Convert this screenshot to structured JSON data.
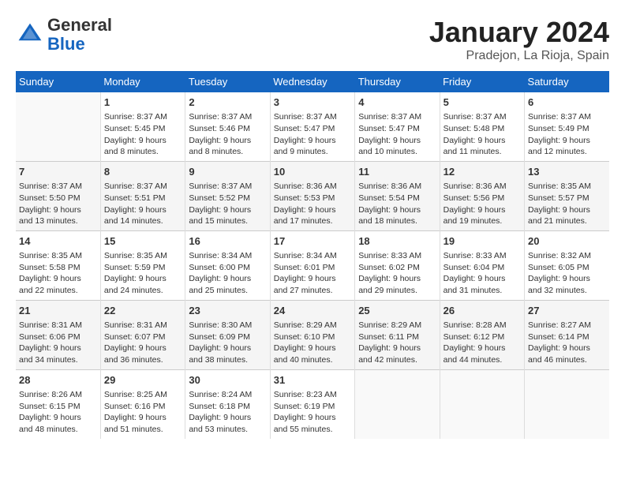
{
  "header": {
    "logo_general": "General",
    "logo_blue": "Blue",
    "month_title": "January 2024",
    "location": "Pradejon, La Rioja, Spain"
  },
  "days_of_week": [
    "Sunday",
    "Monday",
    "Tuesday",
    "Wednesday",
    "Thursday",
    "Friday",
    "Saturday"
  ],
  "weeks": [
    [
      {
        "day": "",
        "info": ""
      },
      {
        "day": "1",
        "info": "Sunrise: 8:37 AM\nSunset: 5:45 PM\nDaylight: 9 hours\nand 8 minutes."
      },
      {
        "day": "2",
        "info": "Sunrise: 8:37 AM\nSunset: 5:46 PM\nDaylight: 9 hours\nand 8 minutes."
      },
      {
        "day": "3",
        "info": "Sunrise: 8:37 AM\nSunset: 5:47 PM\nDaylight: 9 hours\nand 9 minutes."
      },
      {
        "day": "4",
        "info": "Sunrise: 8:37 AM\nSunset: 5:47 PM\nDaylight: 9 hours\nand 10 minutes."
      },
      {
        "day": "5",
        "info": "Sunrise: 8:37 AM\nSunset: 5:48 PM\nDaylight: 9 hours\nand 11 minutes."
      },
      {
        "day": "6",
        "info": "Sunrise: 8:37 AM\nSunset: 5:49 PM\nDaylight: 9 hours\nand 12 minutes."
      }
    ],
    [
      {
        "day": "7",
        "info": "Sunrise: 8:37 AM\nSunset: 5:50 PM\nDaylight: 9 hours\nand 13 minutes."
      },
      {
        "day": "8",
        "info": "Sunrise: 8:37 AM\nSunset: 5:51 PM\nDaylight: 9 hours\nand 14 minutes."
      },
      {
        "day": "9",
        "info": "Sunrise: 8:37 AM\nSunset: 5:52 PM\nDaylight: 9 hours\nand 15 minutes."
      },
      {
        "day": "10",
        "info": "Sunrise: 8:36 AM\nSunset: 5:53 PM\nDaylight: 9 hours\nand 17 minutes."
      },
      {
        "day": "11",
        "info": "Sunrise: 8:36 AM\nSunset: 5:54 PM\nDaylight: 9 hours\nand 18 minutes."
      },
      {
        "day": "12",
        "info": "Sunrise: 8:36 AM\nSunset: 5:56 PM\nDaylight: 9 hours\nand 19 minutes."
      },
      {
        "day": "13",
        "info": "Sunrise: 8:35 AM\nSunset: 5:57 PM\nDaylight: 9 hours\nand 21 minutes."
      }
    ],
    [
      {
        "day": "14",
        "info": "Sunrise: 8:35 AM\nSunset: 5:58 PM\nDaylight: 9 hours\nand 22 minutes."
      },
      {
        "day": "15",
        "info": "Sunrise: 8:35 AM\nSunset: 5:59 PM\nDaylight: 9 hours\nand 24 minutes."
      },
      {
        "day": "16",
        "info": "Sunrise: 8:34 AM\nSunset: 6:00 PM\nDaylight: 9 hours\nand 25 minutes."
      },
      {
        "day": "17",
        "info": "Sunrise: 8:34 AM\nSunset: 6:01 PM\nDaylight: 9 hours\nand 27 minutes."
      },
      {
        "day": "18",
        "info": "Sunrise: 8:33 AM\nSunset: 6:02 PM\nDaylight: 9 hours\nand 29 minutes."
      },
      {
        "day": "19",
        "info": "Sunrise: 8:33 AM\nSunset: 6:04 PM\nDaylight: 9 hours\nand 31 minutes."
      },
      {
        "day": "20",
        "info": "Sunrise: 8:32 AM\nSunset: 6:05 PM\nDaylight: 9 hours\nand 32 minutes."
      }
    ],
    [
      {
        "day": "21",
        "info": "Sunrise: 8:31 AM\nSunset: 6:06 PM\nDaylight: 9 hours\nand 34 minutes."
      },
      {
        "day": "22",
        "info": "Sunrise: 8:31 AM\nSunset: 6:07 PM\nDaylight: 9 hours\nand 36 minutes."
      },
      {
        "day": "23",
        "info": "Sunrise: 8:30 AM\nSunset: 6:09 PM\nDaylight: 9 hours\nand 38 minutes."
      },
      {
        "day": "24",
        "info": "Sunrise: 8:29 AM\nSunset: 6:10 PM\nDaylight: 9 hours\nand 40 minutes."
      },
      {
        "day": "25",
        "info": "Sunrise: 8:29 AM\nSunset: 6:11 PM\nDaylight: 9 hours\nand 42 minutes."
      },
      {
        "day": "26",
        "info": "Sunrise: 8:28 AM\nSunset: 6:12 PM\nDaylight: 9 hours\nand 44 minutes."
      },
      {
        "day": "27",
        "info": "Sunrise: 8:27 AM\nSunset: 6:14 PM\nDaylight: 9 hours\nand 46 minutes."
      }
    ],
    [
      {
        "day": "28",
        "info": "Sunrise: 8:26 AM\nSunset: 6:15 PM\nDaylight: 9 hours\nand 48 minutes."
      },
      {
        "day": "29",
        "info": "Sunrise: 8:25 AM\nSunset: 6:16 PM\nDaylight: 9 hours\nand 51 minutes."
      },
      {
        "day": "30",
        "info": "Sunrise: 8:24 AM\nSunset: 6:18 PM\nDaylight: 9 hours\nand 53 minutes."
      },
      {
        "day": "31",
        "info": "Sunrise: 8:23 AM\nSunset: 6:19 PM\nDaylight: 9 hours\nand 55 minutes."
      },
      {
        "day": "",
        "info": ""
      },
      {
        "day": "",
        "info": ""
      },
      {
        "day": "",
        "info": ""
      }
    ]
  ]
}
